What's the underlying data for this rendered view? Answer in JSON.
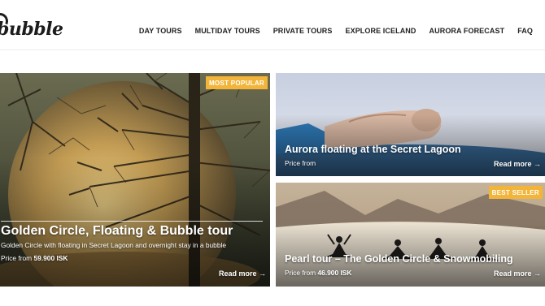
{
  "brand": {
    "logo_text": "bubble"
  },
  "nav": {
    "items": [
      {
        "label": "DAY TOURS"
      },
      {
        "label": "MULTIDAY TOURS"
      },
      {
        "label": "PRIVATE TOURS"
      },
      {
        "label": "EXPLORE ICELAND"
      },
      {
        "label": "AURORA FORECAST"
      },
      {
        "label": "FAQ"
      }
    ]
  },
  "tours": {
    "main": {
      "badge": "MOST POPULAR",
      "title": "Golden Circle, Floating & Bubble tour",
      "description": "Golden Circle with floating in Secret Lagoon and overnight stay in a bubble",
      "price_label": "Price from",
      "price_value": "59.900 ISK",
      "read_more": "Read more →"
    },
    "aurora": {
      "title": "Aurora floating at the Secret Lagoon",
      "price_label": "Price from",
      "read_more": "Read more →"
    },
    "pearl": {
      "badge": "BEST SELLER",
      "title": "Pearl tour – The Golden Circle & Snowmobiling",
      "price_label": "Price from",
      "price_value": "46.900 ISK",
      "read_more": "Read more →"
    }
  },
  "colors": {
    "badge": "#f2b53a",
    "nav_text": "#222222"
  }
}
